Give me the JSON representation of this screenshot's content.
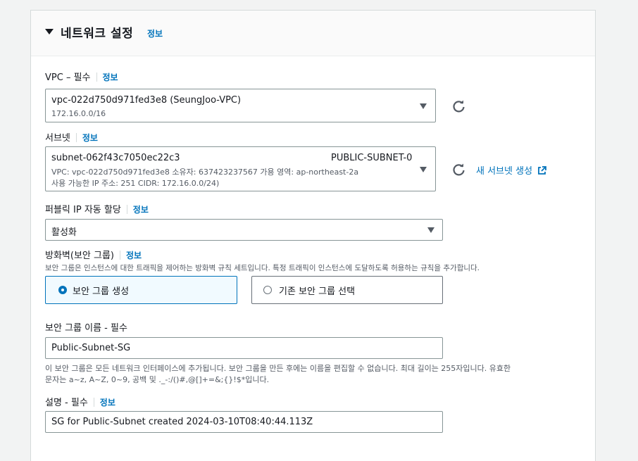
{
  "section": {
    "title": "네트워크 설정",
    "info": "정보"
  },
  "vpc": {
    "label": "VPC – 필수",
    "info": "정보",
    "value": "vpc-022d750d971fed3e8 (SeungJoo-VPC)",
    "sub": "172.16.0.0/16"
  },
  "subnet": {
    "label": "서브넷",
    "info": "정보",
    "value": "subnet-062f43c7050ec22c3",
    "name": "PUBLIC-SUBNET-0",
    "line2": "VPC: vpc-022d750d971fed3e8     소유자: 637423237567     가용 영역: ap-northeast-2a",
    "line3": "사용 가능한 IP 주소: 251     CIDR: 172.16.0.0/24)",
    "create_link": "새 서브넷 생성"
  },
  "public_ip": {
    "label": "퍼블릭 IP 자동 할당",
    "info": "정보",
    "value": "활성화"
  },
  "firewall": {
    "label": "방화벽(보안 그룹)",
    "info": "정보",
    "description": "보안 그룹은 인스턴스에 대한 트래픽을 제어하는 방화벽 규칙 세트입니다. 특정 트래픽이 인스턴스에 도달하도록 허용하는 규칙을 추가합니다.",
    "option_create": "보안 그룹 생성",
    "option_existing": "기존 보안 그룹 선택",
    "selected": "create"
  },
  "sg_name": {
    "label": "보안 그룹 이름 - 필수",
    "value": "Public-Subnet-SG",
    "help_line1": "이 보안 그룹은 모든 네트워크 인터페이스에 추가됩니다. 보안 그룹을 만든 후에는 이름을 편집할 수 없습니다. 최대 길이는 255자입니다. 유효한",
    "help_line2": "문자는 a~z, A~Z, 0~9, 공백 및 ._-:/()#,@[]+=&;{}!$*입니다."
  },
  "description_field": {
    "label": "설명 - 필수",
    "info": "정보",
    "value": "SG for Public-Subnet  created 2024-03-10T08:40:44.113Z"
  },
  "colors": {
    "accent": "#0073bb",
    "selected_bg": "#f1faff",
    "border": "#879596"
  }
}
